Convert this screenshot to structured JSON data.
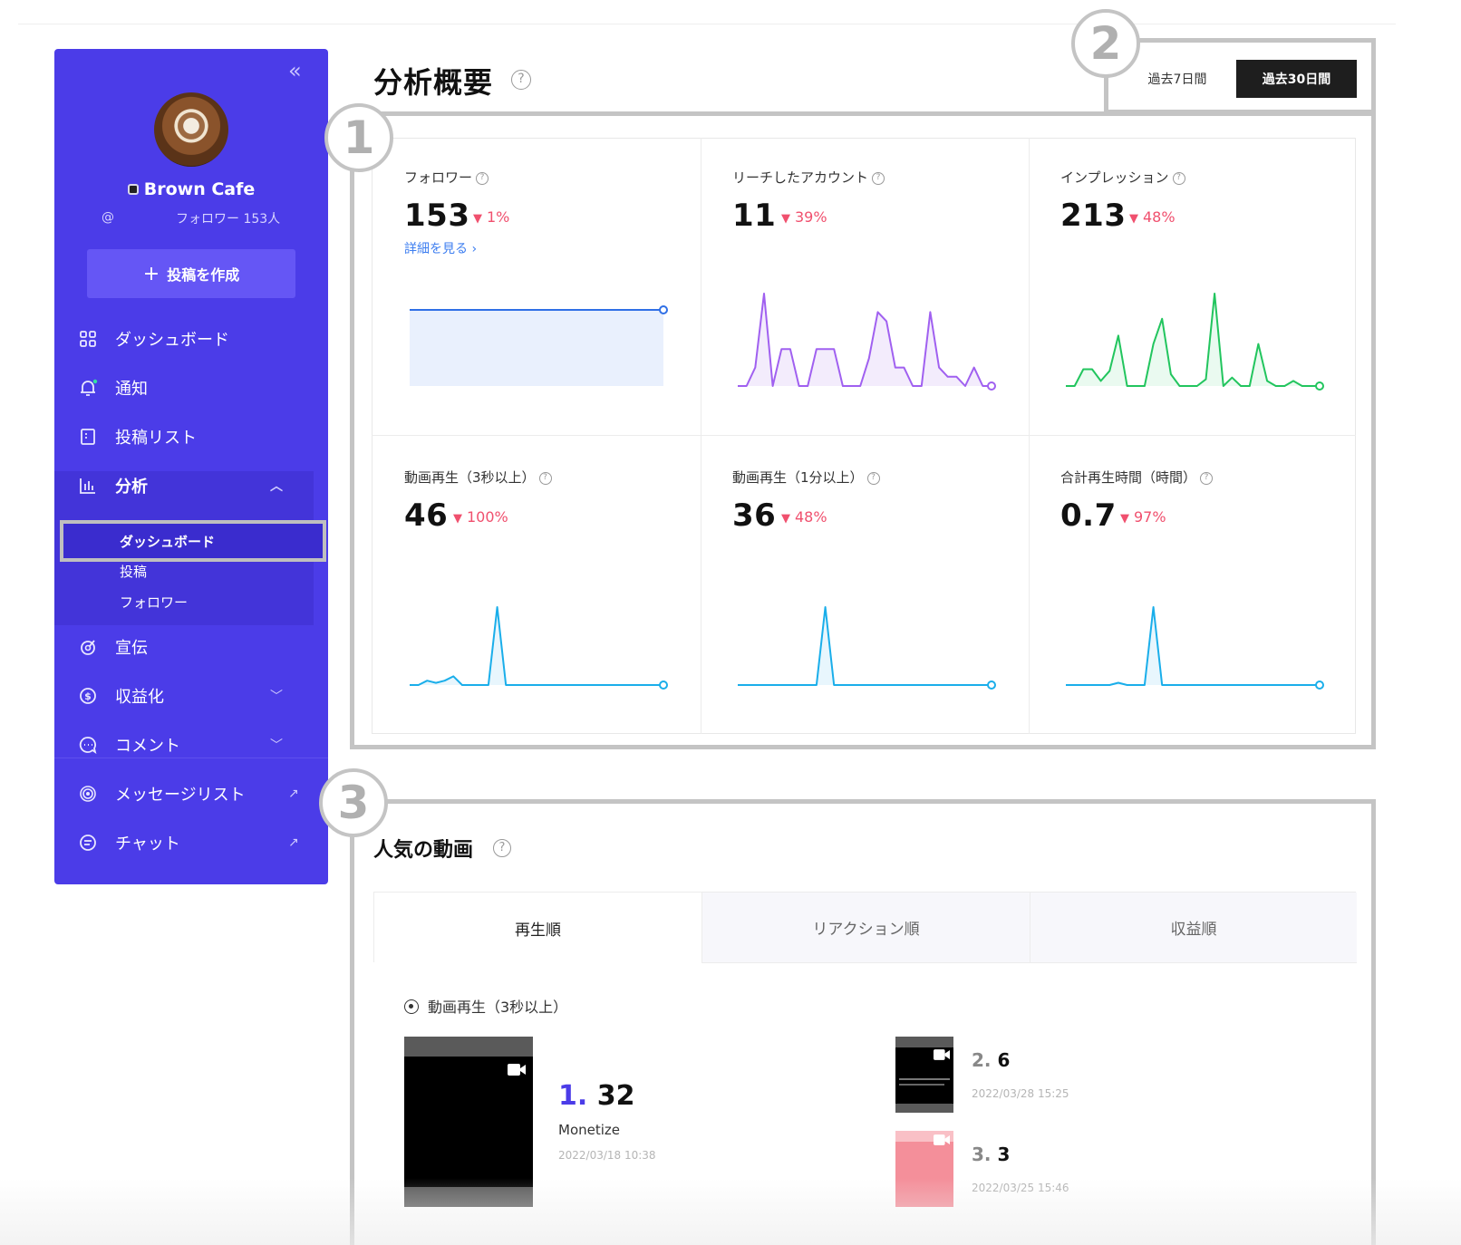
{
  "sidebar": {
    "collapse_label": "«",
    "profile": {
      "name": "Brown Cafe",
      "handle": "@",
      "followers": "フォロワー 153人"
    },
    "create_button": "投稿を作成",
    "nav": {
      "dashboard": "ダッシュボード",
      "notifications": "通知",
      "post_list": "投稿リスト",
      "analysis": "分析",
      "analysis_sub": [
        "ダッシュボード",
        "投稿",
        "フォロワー"
      ],
      "promotion": "宣伝",
      "monetization": "収益化",
      "comments": "コメント",
      "message_list": "メッセージリスト",
      "chat": "チャット"
    }
  },
  "header": {
    "title": "分析概要",
    "period_options": [
      "過去7日間",
      "過去30日間"
    ],
    "selected_period": "過去30日間"
  },
  "markers": [
    "1",
    "2",
    "3"
  ],
  "metrics": [
    {
      "label": "フォロワー",
      "value": "153",
      "change": "1%",
      "link": "詳細を見る ›",
      "color": "#2f6fe6",
      "fill": "#e9f0fd",
      "points": [
        153,
        153,
        153,
        153,
        153,
        153,
        153,
        153,
        153,
        153,
        153,
        153,
        153,
        153,
        153,
        153,
        153,
        153,
        153,
        153,
        153,
        153,
        153,
        153,
        153,
        153,
        153,
        153,
        153,
        153
      ]
    },
    {
      "label": "リーチしたアカウント",
      "value": "11",
      "change": "39%",
      "color": "#a060f0",
      "fill": "#f3ecfc",
      "points": [
        0,
        0,
        2,
        10,
        0,
        4,
        4,
        0,
        0,
        4,
        4,
        4,
        0,
        0,
        0,
        3,
        8,
        7,
        2,
        2,
        0,
        0,
        8,
        2,
        1,
        1,
        0,
        2,
        0,
        0
      ]
    },
    {
      "label": "インプレッション",
      "value": "213",
      "change": "48%",
      "color": "#22c55e",
      "fill": "#eafaf0",
      "points": [
        0,
        0,
        20,
        20,
        6,
        18,
        60,
        0,
        0,
        0,
        50,
        80,
        14,
        0,
        0,
        0,
        8,
        110,
        0,
        10,
        0,
        0,
        50,
        6,
        0,
        0,
        6,
        0,
        0,
        0
      ]
    },
    {
      "label": "動画再生（3秒以上）",
      "value": "46",
      "change": "100%",
      "color": "#1aaeea",
      "fill": "#e8f6fd",
      "points": [
        0,
        0,
        2,
        1,
        2,
        4,
        0,
        0,
        0,
        0,
        36,
        0,
        0,
        0,
        0,
        0,
        0,
        0,
        0,
        0,
        0,
        0,
        0,
        0,
        0,
        0,
        0,
        0,
        0,
        0
      ]
    },
    {
      "label": "動画再生（1分以上）",
      "value": "36",
      "change": "48%",
      "color": "#1aaeea",
      "fill": "#e8f6fd",
      "points": [
        0,
        0,
        0,
        0,
        0,
        0,
        0,
        0,
        0,
        0,
        36,
        0,
        0,
        0,
        0,
        0,
        0,
        0,
        0,
        0,
        0,
        0,
        0,
        0,
        0,
        0,
        0,
        0,
        0,
        0
      ]
    },
    {
      "label": "合計再生時間（時間）",
      "value": "0.7",
      "change": "97%",
      "color": "#1aaeea",
      "fill": "#e8f6fd",
      "points": [
        0,
        0,
        0,
        0,
        0,
        0,
        0.02,
        0,
        0,
        0,
        0.7,
        0,
        0,
        0,
        0,
        0,
        0,
        0,
        0,
        0,
        0,
        0,
        0,
        0,
        0,
        0,
        0,
        0,
        0,
        0
      ]
    }
  ],
  "popular": {
    "title": "人気の動画",
    "tabs": [
      "再生順",
      "リアクション順",
      "収益順"
    ],
    "metric_label": "動画再生（3秒以上）",
    "videos": [
      {
        "rank": "1.",
        "count": "32",
        "title": "Monetize",
        "date": "2022/03/18 10:38",
        "thumb_color": "#000000"
      },
      {
        "rank": "2.",
        "count": "6",
        "date": "2022/03/28 15:25",
        "thumb_color": "#000000"
      },
      {
        "rank": "3.",
        "count": "3",
        "date": "2022/03/25 15:46",
        "thumb_color": "#f48f9a"
      }
    ]
  }
}
